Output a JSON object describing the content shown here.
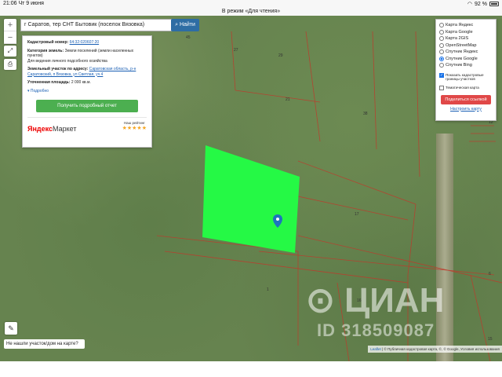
{
  "status": {
    "time": "21:06",
    "date": "Чт 9 июня",
    "mode": "В режим «Для чтения»",
    "battery": "92 %"
  },
  "search": {
    "value": "г Саратов, тер СНТ Бытовик (поселок Вязовка)",
    "button": "Найти"
  },
  "zoom": {
    "plus": "+",
    "minus": "−"
  },
  "info": {
    "cad_label": "Кадастровый номер:",
    "cad_value": "64:32:020607:20",
    "cat_label": "Категория земель:",
    "cat_value": "Земли поселений (земли населенных пунктов)",
    "usage": "Для ведения личного подсобного хозяйства",
    "addr_label": "Земельный участок по адресу:",
    "addr_value": "Саратовская область, р-н Саратовский, п Вязовка, ул Светлая, уч 4",
    "area_label": "Уточненная площадь:",
    "area_value": "2 000 кв.м.",
    "details": "▾ Подробно",
    "report_button": "Получить подробный отчет",
    "market_brand": "Яндекс",
    "market_name": "Маркет",
    "rating_label": "Наш рейтинг",
    "stars": "★★★★★"
  },
  "layers": {
    "options": [
      {
        "label": "Карта Яндекс",
        "selected": false
      },
      {
        "label": "Карта Google",
        "selected": false
      },
      {
        "label": "Карта 2GIS",
        "selected": false
      },
      {
        "label": "OpenStreetMap",
        "selected": false
      },
      {
        "label": "Спутник Яндекс",
        "selected": false
      },
      {
        "label": "Спутник Google",
        "selected": true
      },
      {
        "label": "Спутник Bing",
        "selected": false
      }
    ],
    "show_cadastral": "Показать кадастровые границы участков",
    "thematic": "Тематическая карта",
    "share": "Поделиться ссылкой",
    "setup": "Настроить карту"
  },
  "plot_numbers": [
    "45",
    "27",
    "29",
    "21",
    "38",
    "12",
    "17",
    "6",
    "16",
    "1",
    "15"
  ],
  "bottom": {
    "not_found": "Не нашли участок/дом на карте?",
    "attribution_leaflet": "Leaflet",
    "attribution_rest": "| © Публичная кадастровая карта, ©, © Google, Условия использования"
  },
  "watermark": {
    "brand": "ЦИАН",
    "id": "ID 318509087"
  },
  "colors": {
    "parcel": "#22ff44",
    "boundary": "#c0392b",
    "accent": "#2e6da4"
  }
}
